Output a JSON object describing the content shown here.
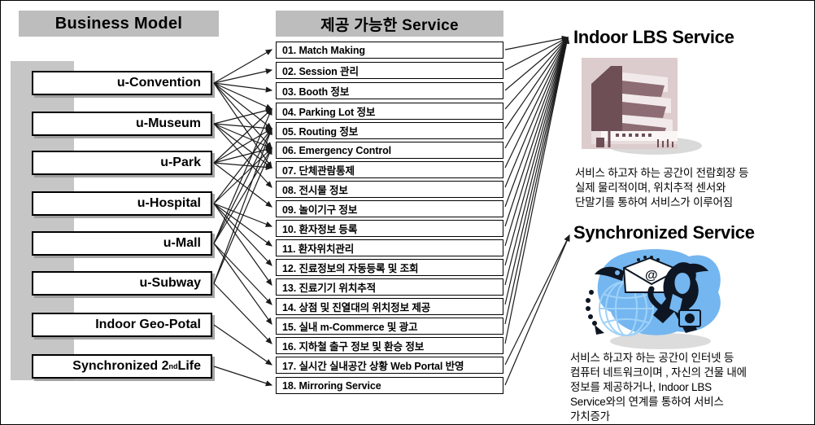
{
  "headers": {
    "business_model": "Business Model",
    "service": "제공 가능한 Service"
  },
  "business_models": [
    {
      "label": "u-Convention"
    },
    {
      "label": "u-Museum"
    },
    {
      "label": "u-Park"
    },
    {
      "label": "u-Hospital"
    },
    {
      "label": "u-Mall"
    },
    {
      "label": "u-Subway"
    },
    {
      "label": "Indoor Geo-Potal"
    },
    {
      "label_pre": "Synchronized 2",
      "label_sup": "nd",
      "label_post": " Life"
    }
  ],
  "services": [
    {
      "label": "01. Match Making"
    },
    {
      "label": "02. Session 관리"
    },
    {
      "label": "03. Booth 정보"
    },
    {
      "label": "04. Parking Lot 정보"
    },
    {
      "label": "05. Routing 정보"
    },
    {
      "label": "06. Emergency Control"
    },
    {
      "label": "07. 단체관람통제"
    },
    {
      "label": "08. 전시물 정보"
    },
    {
      "label": "09. 놀이기구 정보"
    },
    {
      "label": "10. 환자정보 등록"
    },
    {
      "label": "11. 환자위치관리"
    },
    {
      "label": "12. 진료정보의 자동등록 및 조회"
    },
    {
      "label": "13. 진료기기 위치추적"
    },
    {
      "label": "14. 상점 및 진열대의 위치정보 제공"
    },
    {
      "label": "15. 실내 m-Commerce 및 광고"
    },
    {
      "label": "16. 지하철 출구 정보 및 환승 정보"
    },
    {
      "label": "17. 실시간 실내공간 상황 Web Portal 반영"
    },
    {
      "label": "18. Mirroring Service"
    }
  ],
  "right_panel": {
    "lbs": {
      "title": "Indoor LBS Service",
      "description": "서비스 하고자 하는 공간이  전람회장 등\n실제 물리적이며, 위치추적 센서와\n단말기를 통하여 서비스가 이루어짐",
      "clipart_name": "spiral-museum-building-illustration"
    },
    "synchronized": {
      "title": "Synchronized Service",
      "description": "서비스 하고자 하는 공간이  인터넷 등\n컴퓨터 네트워크이며 , 자신의 건물 내에\n정보를 제공하거나, Indoor LBS\nService와의 연계를 통하여 서비스\n가치증가",
      "clipart_name": "globe-email-businessman-illustration"
    }
  },
  "colors": {
    "header_gray": "#bdbdbd",
    "panel_gray": "#c6c6c6",
    "box_border": "#000000",
    "arrow": "#1a1a1a",
    "lbs_clip_primary": "#7a5a60",
    "lbs_clip_light": "#e2d2d2",
    "syn_clip_blue": "#6fb4ef",
    "syn_clip_dark": "#101a28"
  }
}
